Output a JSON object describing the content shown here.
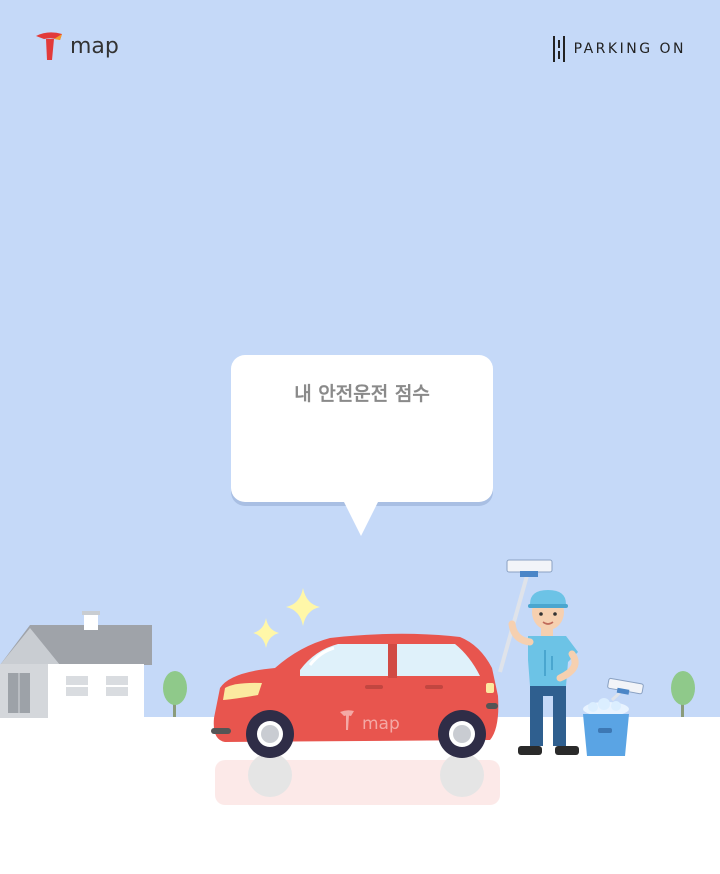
{
  "header": {
    "left_logo": "map",
    "right_logo": "PARKING ON"
  },
  "bubble": {
    "title": "내 안전운전 점수"
  },
  "car": {
    "brand_text": "map"
  },
  "colors": {
    "sky": "#c5d9f8",
    "ground": "#ffffff",
    "car_body": "#e8554e",
    "worker_shirt": "#6cc3e6",
    "bucket": "#5aa4e4"
  },
  "icons": [
    "tmap-logo-icon",
    "parking-on-logo-icon",
    "sparkle-icon"
  ]
}
